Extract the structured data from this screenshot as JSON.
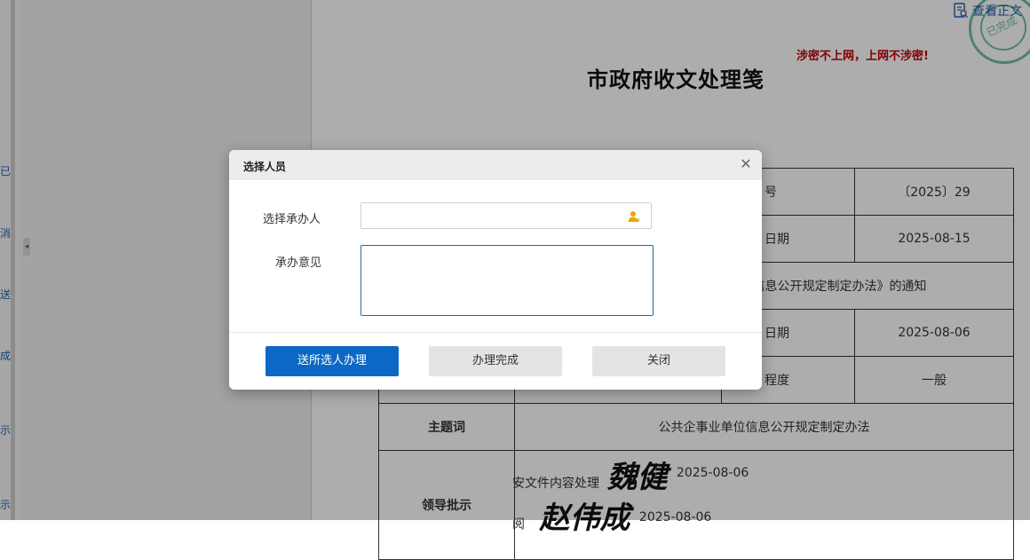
{
  "background": {
    "rail_tabs": [
      "已",
      "消",
      "送",
      "成",
      "示",
      "示"
    ],
    "document": {
      "title": "市政府收文处理笺",
      "secret_warning": "涉密不上网，上网不涉密!",
      "view_body_link": "查看正文",
      "stamp_text": "已完成",
      "rows": [
        {
          "label": "号",
          "value": "〔2025〕29"
        },
        {
          "label": "日期",
          "value": "2025-08-15"
        },
        {
          "label": "",
          "value": "信息公开规定制定办法》的通知"
        },
        {
          "label": "日期",
          "value": "2025-08-06"
        },
        {
          "label": "程度",
          "value": "一般"
        }
      ],
      "subject_label": "主题词",
      "subject_value": "公共企事业单位信息公开规定制定办法",
      "leader_label": "领导批示",
      "instructions": [
        {
          "text": "安文件内容处理",
          "signature": "魏健",
          "date": "2025-08-06"
        },
        {
          "text": "阅",
          "signature": "赵伟成",
          "date": "2025-08-06"
        }
      ]
    }
  },
  "dialog": {
    "title": "选择人员",
    "handler_label": "选择承办人",
    "handler_value": "",
    "opinion_label": "承办意见",
    "opinion_value": "",
    "buttons": {
      "send": "送所选人办理",
      "complete": "办理完成",
      "close": "关闭"
    },
    "colors": {
      "primary": "#0c68c4",
      "person_icon": "#f0a500"
    }
  }
}
